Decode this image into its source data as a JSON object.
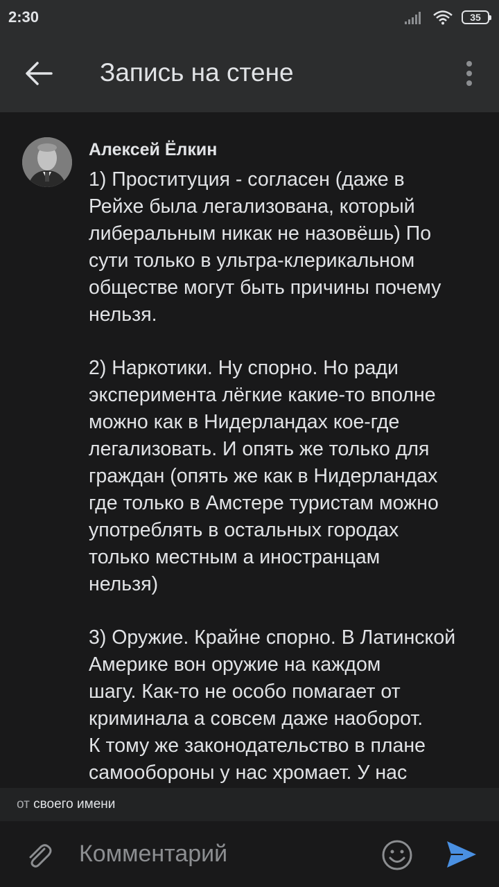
{
  "status_bar": {
    "time": "2:30",
    "battery": "35"
  },
  "app_bar": {
    "title": "Запись на стене"
  },
  "comment": {
    "author": "Алексей Ёлкин",
    "text": "1) Проституция - согласен (даже в\nРейхе была легализована, который\nлиберальным никак не назовёшь) По\nсути только в ультра-клерикальном\nобществе могут быть причины почему\nнельзя.\n\n2) Наркотики. Ну спорно. Но ради\nэксперимента лёгкие какие-то вполне\nможно как в Нидерландах кое-где\nлегализовать. И опять же только для\nграждан (опять же как в Нидерландах\nгде только в Амстере туристам можно\nупотреблять в остальных городах\nтолько местным а иностранцам\nнельзя)\n\n3) Оружие. Крайне спорно. В Латинской\nАмерике вон оружие на каждом\nшагу. Как-то не особо помагает от\nкриминала а совсем даже наоборот.\nК тому же законодательство в плане\nсамообороны у нас хромает. У нас"
  },
  "from_bar": {
    "prefix": "от",
    "name": "своего имени"
  },
  "input": {
    "placeholder": "Комментарий"
  },
  "icons": {
    "back": "arrow-left-icon",
    "menu": "more-vertical-icon",
    "attach": "paperclip-icon",
    "emoji": "smile-icon",
    "send": "send-icon"
  },
  "colors": {
    "accent": "#4a90e2",
    "background": "#19191a",
    "bar": "#2c2d2e"
  }
}
